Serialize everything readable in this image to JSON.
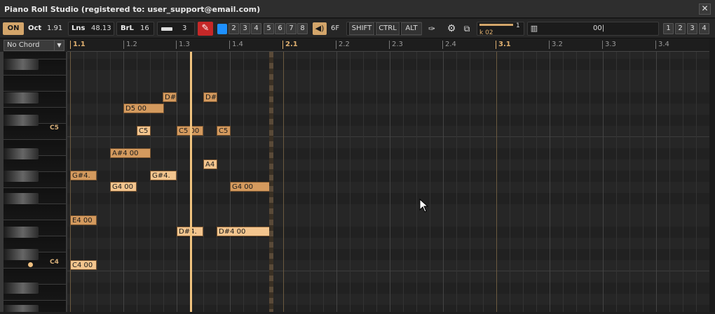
{
  "window": {
    "title": "Piano Roll Studio  (registered to: user_support@email.com)",
    "close": "✕"
  },
  "toolbar": {
    "on": "ON",
    "oct_label": "Oct",
    "oct_value": "1.91",
    "lns_label": "Lns",
    "lns_value": "48.13",
    "brl_label": "BrL",
    "brl_value": "16",
    "quant_value": "3",
    "track_buttons": [
      "2",
      "3",
      "4",
      "5",
      "6",
      "7",
      "8"
    ],
    "vol_value": "6F",
    "shift": "SHIFT",
    "ctrl": "CTRL",
    "alt": "ALT",
    "k_label": "k 02",
    "k_value": "1",
    "piano_value": "00|",
    "page_buttons": [
      "1",
      "2",
      "3",
      "4"
    ]
  },
  "chord": {
    "selected": "No Chord"
  },
  "ruler": {
    "ticks": [
      "1.1",
      "1.2",
      "1.3",
      "1.4",
      "2.1",
      "2.2",
      "2.3",
      "2.4",
      "3.1",
      "3.2",
      "3.3",
      "3.4"
    ]
  },
  "keys": {
    "c5": "C5",
    "c4": "C4"
  },
  "notes": [
    {
      "text": "D#",
      "pitch": "D#5",
      "bar": 1.45
    },
    {
      "text": "D#",
      "pitch": "D#5",
      "bar": 1.6
    },
    {
      "text": "D5 00",
      "pitch": "D5",
      "bar": 1.25
    },
    {
      "text": "C5",
      "pitch": "C5",
      "bar": 1.3
    },
    {
      "text": "C5 00",
      "pitch": "C5",
      "bar": 1.55
    },
    {
      "text": "C5",
      "pitch": "C5",
      "bar": 1.72
    },
    {
      "text": "A#4 00",
      "pitch": "A#4",
      "bar": 1.2
    },
    {
      "text": "A4",
      "pitch": "A4",
      "bar": 1.6
    },
    {
      "text": "G#4.",
      "pitch": "G#4",
      "bar": 1.0
    },
    {
      "text": "G#4.",
      "pitch": "G#4",
      "bar": 1.38
    },
    {
      "text": "G4 00",
      "pitch": "G4",
      "bar": 1.2
    },
    {
      "text": "G4 00",
      "pitch": "G4",
      "bar": 1.7
    },
    {
      "text": "E4 00",
      "pitch": "E4",
      "bar": 1.0
    },
    {
      "text": "D#4.",
      "pitch": "D#4",
      "bar": 1.55
    },
    {
      "text": "D#4 00",
      "pitch": "D#4",
      "bar": 1.72
    },
    {
      "text": "C4 00",
      "pitch": "C4",
      "bar": 1.0
    }
  ],
  "colors": {
    "note": "#d49a5e",
    "accent": "#f0c37e",
    "record": "#c62828",
    "blue": "#1e90ff"
  }
}
